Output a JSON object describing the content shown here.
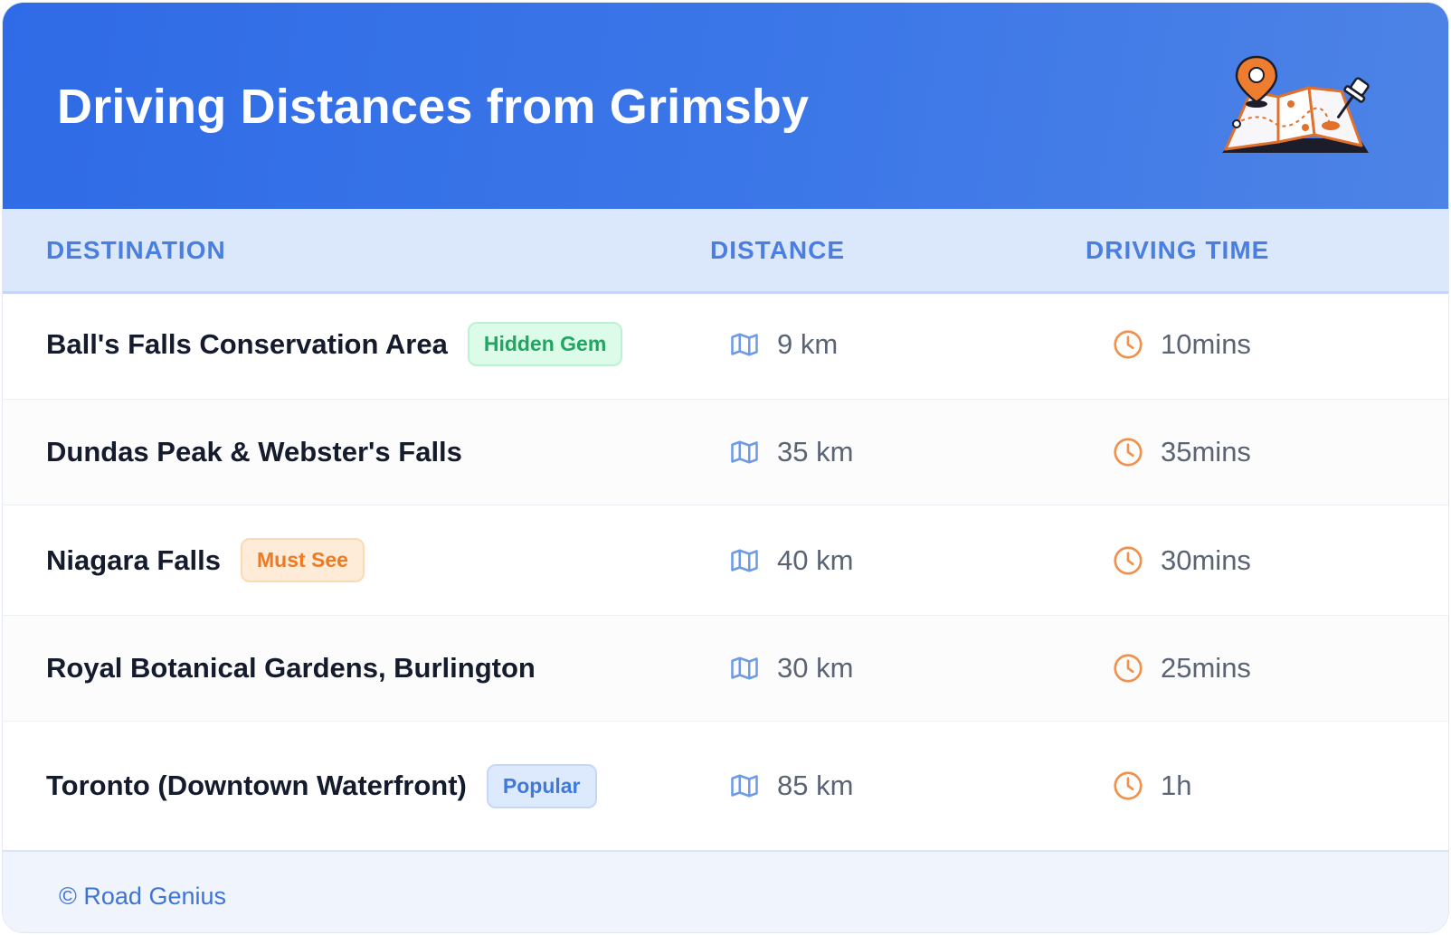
{
  "header": {
    "title": "Driving Distances from Grimsby",
    "illustration_icon": "folded-map-with-pins-icon"
  },
  "table": {
    "columns": [
      "DESTINATION",
      "DISTANCE",
      "DRIVING TIME"
    ],
    "rows": [
      {
        "destination": "Ball's Falls Conservation Area",
        "badge": "Hidden Gem",
        "badge_color": "green",
        "distance": "9 km",
        "time": "10mins"
      },
      {
        "destination": "Dundas Peak & Webster's Falls",
        "badge": "",
        "badge_color": "",
        "distance": "35 km",
        "time": "35mins"
      },
      {
        "destination": "Niagara Falls",
        "badge": "Must See",
        "badge_color": "orange",
        "distance": "40 km",
        "time": "30mins"
      },
      {
        "destination": "Royal Botanical Gardens, Burlington",
        "badge": "",
        "badge_color": "",
        "distance": "30 km",
        "time": "25mins"
      },
      {
        "destination": "Toronto (Downtown Waterfront)",
        "badge": "Popular",
        "badge_color": "blue",
        "distance": "85 km",
        "time": "1h"
      }
    ],
    "distance_icon": "map-icon",
    "time_icon": "clock-icon"
  },
  "footer": {
    "credit": "© Road Genius"
  },
  "colors": {
    "header_start": "#2f6be6",
    "header_end": "#4d83e6",
    "header_row_bg": "#dbe8fc",
    "accent_blue": "#4a7ee0",
    "clock_orange": "#f0924e",
    "map_icon_blue": "#6f9be6"
  }
}
